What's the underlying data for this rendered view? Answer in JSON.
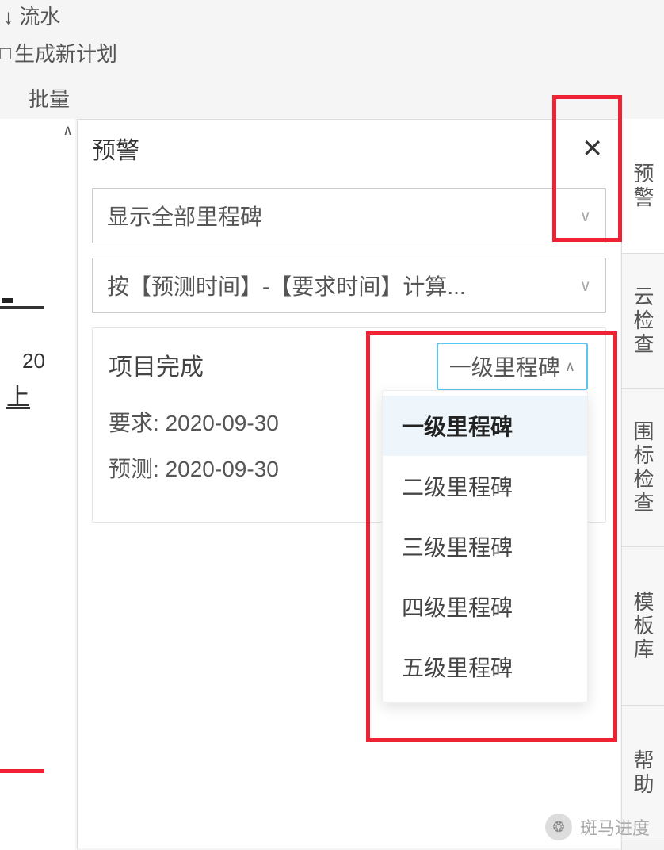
{
  "menu": {
    "row1": "流水",
    "row2": "生成新计划",
    "row3": "批量"
  },
  "left": {
    "twenty": "20",
    "shang": "上"
  },
  "panel": {
    "title": "预警",
    "select1": "显示全部里程碑",
    "select2": "按【预测时间】-【要求时间】计算...",
    "card": {
      "heading": "项目完成",
      "req_label": "要求",
      "req_value": "2020-09-30",
      "pred_label": "预测",
      "pred_value": "2020-09-30",
      "mini_label": "一级里程碑"
    },
    "options": [
      "一级里程碑",
      "二级里程碑",
      "三级里程碑",
      "四级里程碑",
      "五级里程碑"
    ]
  },
  "tabs": [
    "预警",
    "云检查",
    "围标检查",
    "模板库",
    "帮助"
  ],
  "watermark": "斑马进度"
}
